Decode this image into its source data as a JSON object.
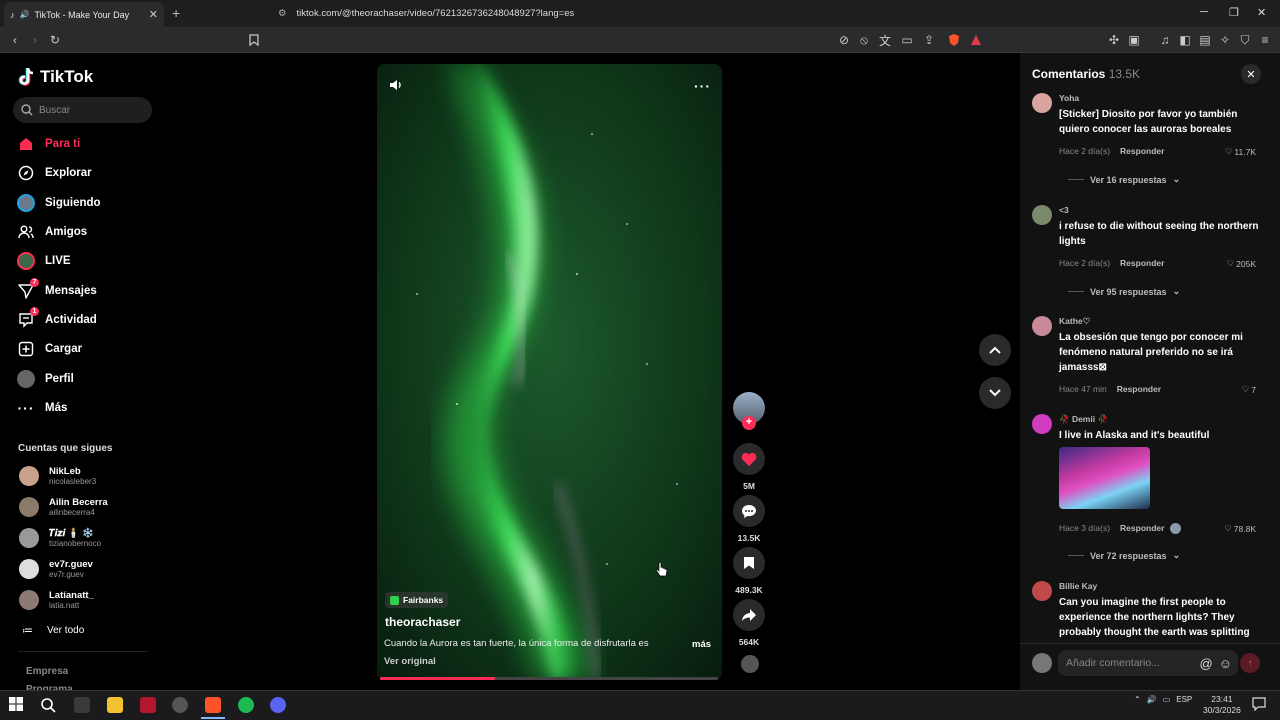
{
  "browser": {
    "tab_title": "TikTok - Make Your Day",
    "url": "tiktok.com/@theorachaser/video/7621326736248048927?lang=es",
    "new_tab_symbol": "+",
    "tab_close_symbol": "✕"
  },
  "sidebar": {
    "logo": "TikTok",
    "search_placeholder": "Buscar",
    "nav": [
      {
        "label": "Para ti",
        "icon": "home-icon",
        "active": true
      },
      {
        "label": "Explorar",
        "icon": "compass-icon"
      },
      {
        "label": "Siguiendo",
        "icon": "following-avatar-icon"
      },
      {
        "label": "Amigos",
        "icon": "friends-icon"
      },
      {
        "label": "LIVE",
        "icon": "live-icon"
      },
      {
        "label": "Mensajes",
        "icon": "messages-icon",
        "badge": "7"
      },
      {
        "label": "Actividad",
        "icon": "activity-icon",
        "badge": "1"
      },
      {
        "label": "Cargar",
        "icon": "upload-icon"
      },
      {
        "label": "Perfil",
        "icon": "profile-avatar-icon"
      },
      {
        "label": "Más",
        "icon": "more-icon"
      }
    ],
    "following_title": "Cuentas que sigues",
    "accounts": [
      {
        "name": "NikLeb",
        "user": "nicolasleber3"
      },
      {
        "name": "Ailin Becerra",
        "user": "ailinbecerra4"
      },
      {
        "name": "𝑻𝒊𝒛𝒊 🕯️ ❄️",
        "user": "tizianobernoco"
      },
      {
        "name": "ev7r.guev",
        "user": "ev7r.guev"
      },
      {
        "name": "Latíanatt_",
        "user": "latia.natt"
      }
    ],
    "see_all": "Ver todo",
    "footer_1": "Empresa",
    "footer_2": "Programa"
  },
  "video": {
    "location": "Fairbanks",
    "author": "theorachaser",
    "caption": "Cuando la Aurora es tan fuerte, la única forma de disfrutarla es",
    "more": "más",
    "see_original": "Ver original",
    "progress": 0.34,
    "likes": "5M",
    "comments": "13.5K",
    "saves": "489.3K",
    "shares": "564K"
  },
  "comments": {
    "title": "Comentarios",
    "count": "13.5K",
    "composer_placeholder": "Añadir comentario...",
    "items": [
      {
        "user": "Yoha",
        "text": "[Sticker] Diosito por favor yo también quiero conocer las auroras boreales",
        "time": "Hace 2 día(s)",
        "reply": "Responder",
        "likes": "11.7K",
        "replies": "Ver 16 respuestas"
      },
      {
        "user": "<3",
        "text": "i refuse to die without seeing the northern lights",
        "time": "Hace 2 día(s)",
        "reply": "Responder",
        "likes": "205K",
        "replies": "Ver 95 respuestas"
      },
      {
        "user": "Kathe♡",
        "text": "La obsesión que tengo por conocer mi fenómeno natural preferido no se irá jamasss⊠",
        "time": "Hace 47 min",
        "reply": "Responder",
        "likes": "7"
      },
      {
        "user": "🥀 Demii 🥀",
        "text": "I live in Alaska and it's beautiful",
        "time": "Hace 3 día(s)",
        "reply": "Responder",
        "likes": "78.8K",
        "replies": "Ver 72 respuestas"
      },
      {
        "user": "Billie Kay",
        "text": "Can you imagine the first people to experience the northern lights? They probably thought the earth was splitting"
      }
    ]
  },
  "taskbar": {
    "lang": "ESP",
    "time": "23:41",
    "date": "30/3/2026"
  },
  "colors": {
    "accent": "#fe2c55",
    "panel": "#121212",
    "aurora": "#2fd14a"
  }
}
